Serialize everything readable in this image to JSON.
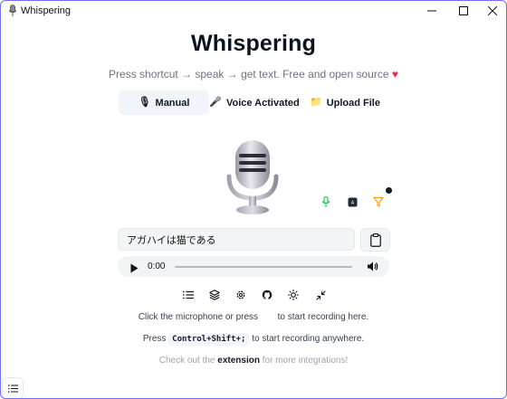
{
  "window": {
    "title": "Whispering"
  },
  "header": {
    "title": "Whispering",
    "tagline_text": "Press shortcut → speak → get text. Free and open source",
    "tagline_heart": "♥"
  },
  "tabs": [
    {
      "label": "Manual",
      "icon": "🎙",
      "active": true
    },
    {
      "label": "Voice Activated",
      "icon": "🎤",
      "active": false
    },
    {
      "label": "Upload File",
      "icon": "📁",
      "active": false
    }
  ],
  "transcript": {
    "value": "アガハイは猫である"
  },
  "audio": {
    "time": "0:00",
    "progress": 0
  },
  "hints": {
    "line1_a": "Click the microphone or press",
    "line1_b": "to start recording here.",
    "line2_a": "Press",
    "line2_key": "Control+Shift+;",
    "line2_b": "to start recording anywhere."
  },
  "footer": {
    "before": "Check out the",
    "link": "extension",
    "after": "for more integrations!"
  },
  "icons": {
    "mic_main": "microphone-icon",
    "small": [
      "microphone-small-icon",
      "transcription-box-icon",
      "filter-icon"
    ],
    "toolbar": [
      "list-icon",
      "layers-icon",
      "settings-icon",
      "github-icon",
      "sun-icon",
      "minimize-icon"
    ]
  },
  "colors": {
    "accent_green": "#22c55e",
    "accent_amber": "#f59e0b",
    "heart": "#e0314b",
    "border": "#6f6ff0"
  }
}
